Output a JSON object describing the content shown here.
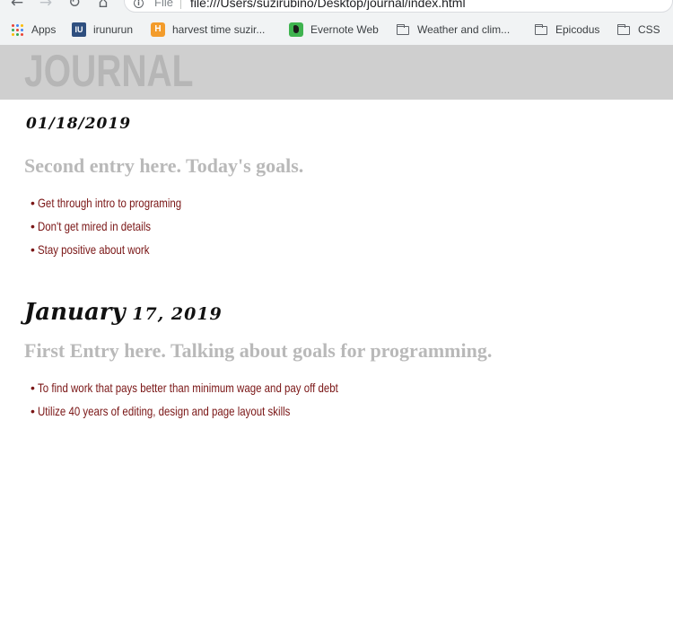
{
  "browser": {
    "address_scheme": "File",
    "url": "file:///Users/suzirubino/Desktop/journal/index.html",
    "bookmarks": [
      {
        "label": "Apps",
        "icon": "apps-grid-icon"
      },
      {
        "label": "irunurun",
        "icon": "irunurun-icon"
      },
      {
        "label": "harvest time suzir...",
        "icon": "harvest-icon"
      },
      {
        "label": "Evernote Web",
        "icon": "evernote-icon"
      },
      {
        "label": "Weather and clim...",
        "icon": "folder-icon"
      },
      {
        "label": "Epicodus",
        "icon": "folder-icon"
      },
      {
        "label": "CSS",
        "icon": "folder-icon"
      }
    ]
  },
  "page": {
    "site_title": "JOURNAL",
    "entries": [
      {
        "date": "01/18/2019",
        "heading": "Second entry here. Today's goals.",
        "goals": [
          "Get through intro to programing",
          "Don't get mired in details",
          "Stay positive about work"
        ]
      },
      {
        "date_word": "January",
        "date_rest": " 17, 2019",
        "heading": "First Entry here. Talking about goals for programming.",
        "goals": [
          "To find work that pays better than minimum wage and pay off debt",
          "Utilize 40 years of editing, design and page layout skills"
        ]
      }
    ]
  },
  "colors": {
    "header_band": "#cfcfcf",
    "site_title": "#b6b6b6",
    "entry_heading": "#b9b9b9",
    "goal_text": "#7a1616"
  }
}
